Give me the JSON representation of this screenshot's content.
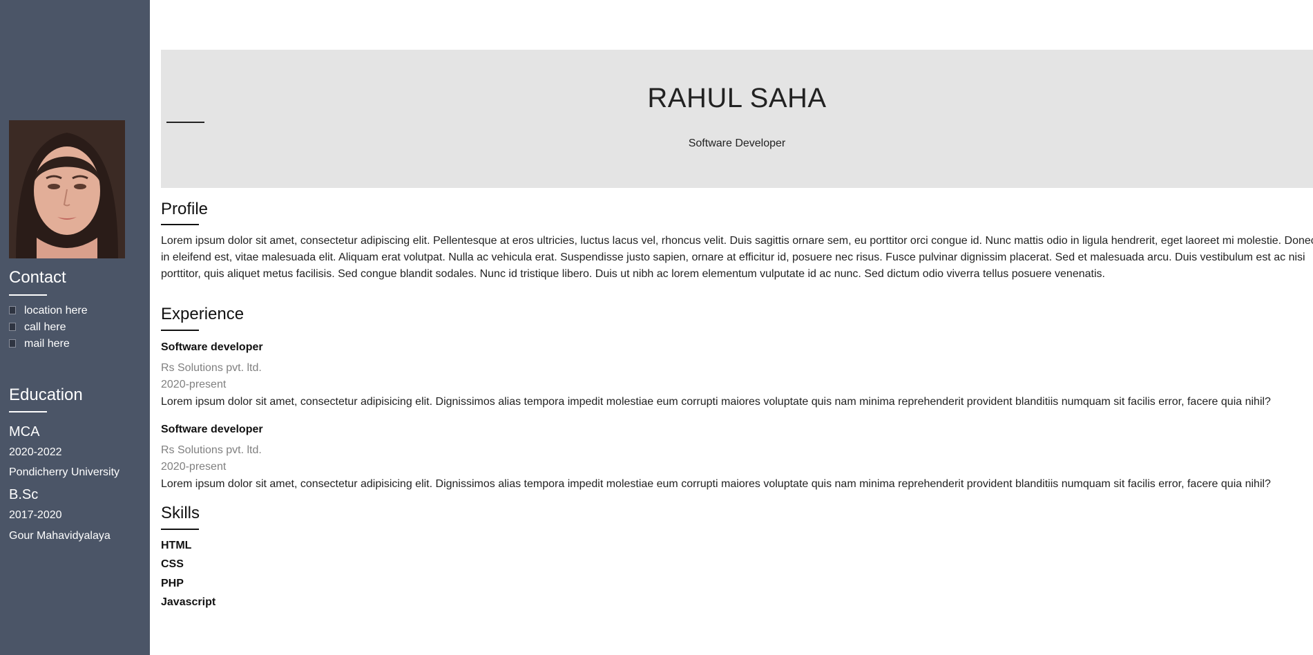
{
  "sidebar": {
    "photo_alt": "profile photo",
    "contact": {
      "heading": "Contact",
      "items": [
        {
          "icon": "location-icon",
          "label": "location here"
        },
        {
          "icon": "phone-icon",
          "label": "call here"
        },
        {
          "icon": "mail-icon",
          "label": "mail here"
        }
      ]
    },
    "education": {
      "heading": "Education",
      "entries": [
        {
          "degree": "MCA",
          "years": "2020-2022",
          "institution": "Pondicherry University"
        },
        {
          "degree": "B.Sc",
          "years": "2017-2020",
          "institution": "Gour Mahavidyalaya"
        }
      ]
    }
  },
  "header": {
    "name": "RAHUL SAHA",
    "role": "Software Developer"
  },
  "profile": {
    "heading": "Profile",
    "lines": [
      "Lorem ipsum dolor sit amet, consectetur adipiscing elit. Pellentesque at eros ultricies, luctus lacus vel, rhoncus velit. Duis sagittis ornare sem, eu porttitor orci congue id. Nunc mattis odio in ligula hendrerit, eget laoreet mi molestie. Donec",
      "in eleifend est, vitae malesuada elit. Aliquam erat volutpat. Nulla ac vehicula erat. Suspendisse justo sapien, ornare at efficitur id, posuere nec risus. Fusce pulvinar dignissim placerat. Sed et malesuada arcu. Duis vestibulum est ac nisi",
      "porttitor, quis aliquet metus facilisis. Sed congue blandit sodales. Nunc id tristique libero. Duis ut nibh ac lorem elementum vulputate id ac nunc. Sed dictum odio viverra tellus posuere venenatis."
    ]
  },
  "experience": {
    "heading": "Experience",
    "jobs": [
      {
        "title": "Software developer",
        "company": "Rs Solutions pvt. ltd.",
        "period": "2020-present",
        "description": "Lorem ipsum dolor sit amet, consectetur adipisicing elit. Dignissimos alias tempora impedit molestiae eum corrupti maiores voluptate quis nam minima reprehenderit provident blanditiis numquam sit facilis error, facere quia nihil?"
      },
      {
        "title": "Software developer",
        "company": "Rs Solutions pvt. ltd.",
        "period": "2020-present",
        "description": "Lorem ipsum dolor sit amet, consectetur adipisicing elit. Dignissimos alias tempora impedit molestiae eum corrupti maiores voluptate quis nam minima reprehenderit provident blanditiis numquam sit facilis error, facere quia nihil?"
      }
    ]
  },
  "skills": {
    "heading": "Skills",
    "items": [
      "HTML",
      "CSS",
      "PHP",
      "Javascript"
    ]
  },
  "colors": {
    "sidebar_bg": "#4b5567",
    "header_bg": "#e4e4e4",
    "muted_text": "#808080"
  }
}
